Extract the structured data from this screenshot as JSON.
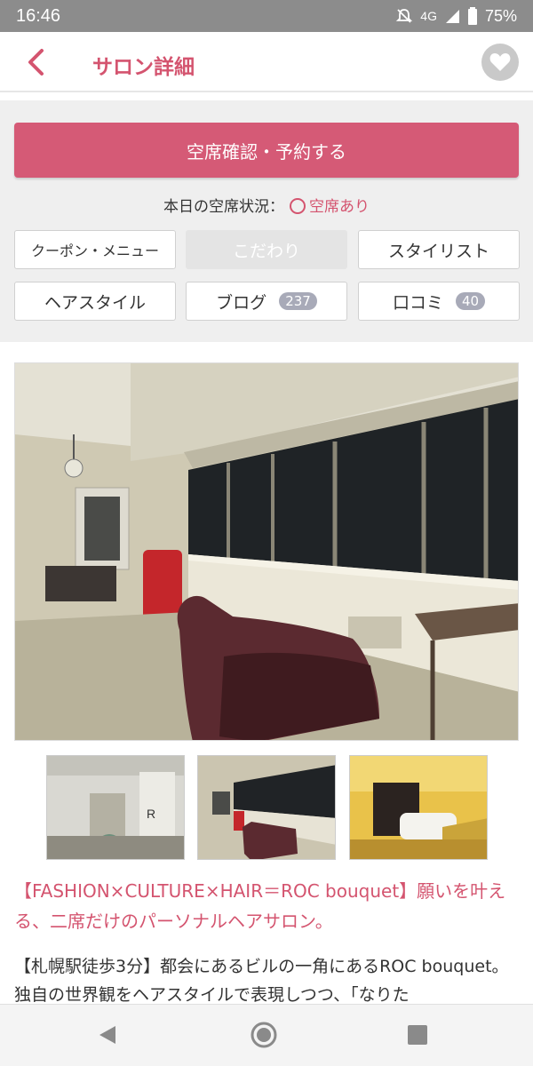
{
  "status_bar": {
    "time": "16:46",
    "network": "4G",
    "battery": "75%",
    "icons": [
      "mute-icon",
      "signal-icon",
      "battery-icon"
    ]
  },
  "header": {
    "title": "サロン詳細",
    "back_icon": "chevron-left-icon",
    "favorite_icon": "heart-icon"
  },
  "panel": {
    "reserve_label": "空席確認・予約する",
    "availability_label": "本日の空席状況：",
    "availability_value": "空席あり",
    "tabs": [
      {
        "label": "クーポン・メニュー",
        "disabled": false
      },
      {
        "label": "こだわり",
        "disabled": true
      },
      {
        "label": "スタイリスト",
        "disabled": false
      },
      {
        "label": "ヘアスタイル",
        "disabled": false
      },
      {
        "label": "ブログ",
        "badge": "237",
        "disabled": false
      },
      {
        "label": "口コミ",
        "badge": "40",
        "disabled": false
      }
    ]
  },
  "photos": {
    "main": "salon-interior-photo",
    "thumbnails": [
      "salon-entrance-photo",
      "salon-interior-photo",
      "salon-shampoo-area-photo"
    ]
  },
  "salon": {
    "catchphrase": "【FASHION×CULTURE×HAIR＝ROC bouquet】願いを叶える、二席だけのパーソナルヘアサロン。",
    "description": "【札幌駅徒歩3分】都会にあるビルの一角にあるROC bouquet。独自の世界観をヘアスタイルで表現しつつ、「なりた"
  },
  "colors": {
    "accent": "#d4546f",
    "reserve_button": "#d55a76",
    "status_bar": "#8c8c8c",
    "panel_bg": "#efefef"
  },
  "nav_bar": {
    "icons": [
      "nav-back-icon",
      "nav-home-icon",
      "nav-recent-icon"
    ]
  }
}
